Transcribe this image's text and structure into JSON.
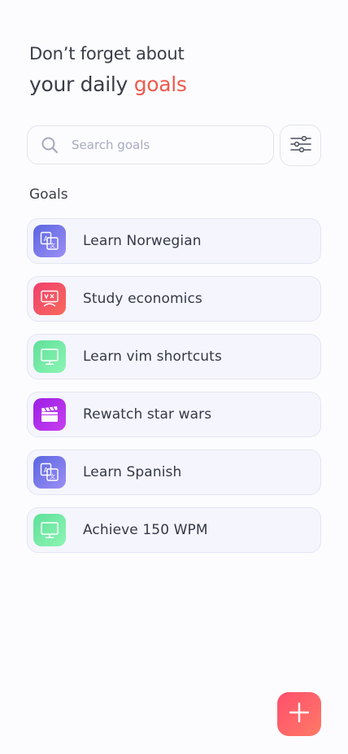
{
  "header": {
    "line1": "Don’t forget about",
    "line2_prefix": "your daily ",
    "line2_accent": "goals",
    "accent_color": "#ef5a4e"
  },
  "search": {
    "placeholder": "Search goals",
    "value": "",
    "icon": "search-icon"
  },
  "filter": {
    "icon": "sliders-icon"
  },
  "goals_section": {
    "title": "Goals",
    "items": [
      {
        "label": "Learn Norwegian",
        "icon": "translate-icon",
        "gradient": [
          "#5a65e0",
          "#9c8ff5"
        ]
      },
      {
        "label": "Study economics",
        "icon": "presentation-icon",
        "gradient": [
          "#ef3f6e",
          "#fb6a5a"
        ]
      },
      {
        "label": "Learn vim shortcuts",
        "icon": "monitor-icon",
        "gradient": [
          "#5fe09a",
          "#8df5b4"
        ]
      },
      {
        "label": "Rewatch star wars",
        "icon": "clapperboard-icon",
        "gradient": [
          "#9b1ee4",
          "#c840f0"
        ]
      },
      {
        "label": "Learn Spanish",
        "icon": "translate-icon",
        "gradient": [
          "#5a65e0",
          "#9c8ff5"
        ]
      },
      {
        "label": "Achieve 150 WPM",
        "icon": "monitor-icon",
        "gradient": [
          "#5fe09a",
          "#8df5b4"
        ]
      }
    ]
  },
  "fab": {
    "icon": "plus-icon",
    "gradient": [
      "#ff4f6d",
      "#ff7a66"
    ]
  }
}
